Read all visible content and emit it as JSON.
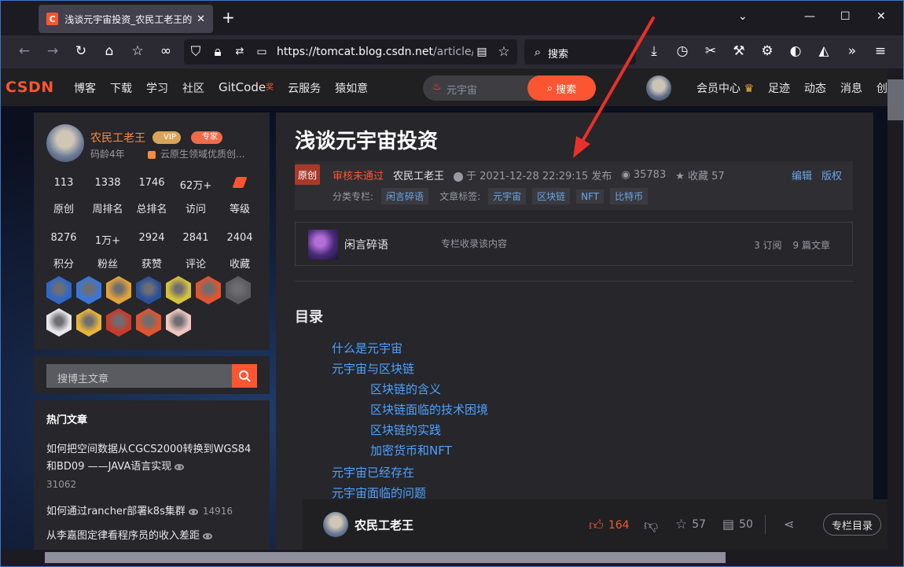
{
  "browser": {
    "tab_title": "浅谈元宇宙投资_农民工老王的博客",
    "tab_favicon": "C",
    "url_host": "https://tomcat.blog.csdn.net",
    "url_path": "/article/d",
    "search_placeholder": "搜索"
  },
  "csdn_header": {
    "logo": "CSDN",
    "nav": [
      "博客",
      "下载",
      "学习",
      "社区",
      "GitCode",
      "云服务",
      "猿如意"
    ],
    "gitcode_badge": "奖",
    "search_placeholder": "元宇宙",
    "search_button": "搜索",
    "right_links": [
      "会员中心",
      "足迹",
      "动态",
      "消息",
      "创"
    ]
  },
  "profile": {
    "name": "农民工老王",
    "vip_badge": "VIP",
    "expert_badge": "专家",
    "age": "码龄4年",
    "field": "云原生领域优质创...",
    "stats_row1": [
      {
        "value": "113",
        "label": "原创"
      },
      {
        "value": "1338",
        "label": "周排名"
      },
      {
        "value": "1746",
        "label": "总排名"
      },
      {
        "value": "62万+",
        "label": "访问"
      },
      {
        "value": "",
        "label": "等级"
      }
    ],
    "stats_row2": [
      {
        "value": "8276",
        "label": "积分"
      },
      {
        "value": "1万+",
        "label": "粉丝"
      },
      {
        "value": "2924",
        "label": "获赞"
      },
      {
        "value": "2841",
        "label": "评论"
      },
      {
        "value": "2404",
        "label": "收藏"
      }
    ],
    "medals": [
      {
        "name": "rocket-medal-blue",
        "color": "#2f67c8"
      },
      {
        "name": "rocket-medal-blue-2",
        "color": "#3a76d8"
      },
      {
        "name": "1024-medal-gold",
        "color": "#e2a33a"
      },
      {
        "name": "rocket-medal-navy",
        "color": "#2a4f9a"
      },
      {
        "name": "creator-medal-rainbow",
        "color": "#d8c23a"
      },
      {
        "name": "gift-medal-red",
        "color": "#e2542e"
      },
      {
        "name": "qi-medal-gray",
        "color": "#5a5a61"
      },
      {
        "name": "1024-medal-white",
        "color": "#e8e8ea"
      },
      {
        "name": "medal-gold-ribbon",
        "color": "#e8b43a"
      },
      {
        "name": "pen-medal-red",
        "color": "#c83a2a"
      },
      {
        "name": "monkey-medal-red",
        "color": "#e2542e"
      },
      {
        "name": "monkey-medal-pink",
        "color": "#f0c8c0"
      }
    ]
  },
  "side_search": {
    "placeholder": "搜博主文章"
  },
  "hot": {
    "title": "热门文章",
    "items": [
      {
        "text": "如何把空间数据从CGCS2000转换到WGS84和BD09 ——JAVA语言实现",
        "count": "31062"
      },
      {
        "text": "如何通过rancher部署k8s集群",
        "count": "14916"
      },
      {
        "text": "从李嘉图定律看程序员的收入差距",
        "count": ""
      }
    ]
  },
  "article": {
    "title": "浅谈元宇宙投资",
    "original": "原创",
    "review_status": "审核未通过",
    "author": "农民工老王",
    "published": "于 2021-12-28 22:29:15 发布",
    "views": "35783",
    "favorites": "收藏 57",
    "edit": "编辑",
    "copyright": "版权",
    "column_label": "分类专栏:",
    "column_tag": "闲言碎语",
    "tags_label": "文章标签:",
    "tags": [
      "元宇宙",
      "区块链",
      "NFT",
      "比特币"
    ],
    "column_card": {
      "name": "闲言碎语",
      "desc": "专栏收录该内容",
      "subs": "3 订阅",
      "articles": "9 篇文章"
    },
    "toc_title": "目录",
    "toc": [
      {
        "text": "什么是元宇宙",
        "level": 1
      },
      {
        "text": "元宇宙与区块链",
        "level": 1
      },
      {
        "text": "区块链的含义",
        "level": 2
      },
      {
        "text": "区块链面临的技术困境",
        "level": 2
      },
      {
        "text": "区块链的实践",
        "level": 2
      },
      {
        "text": "加密货币和NFT",
        "level": 2
      },
      {
        "text": "元宇宙已经存在",
        "level": 1
      },
      {
        "text": "元宇宙面临的问题",
        "level": 1
      }
    ]
  },
  "toolbar": {
    "author": "农民工老王",
    "likes": "164",
    "favorites": "57",
    "comments": "50",
    "column_button": "专栏目录"
  },
  "colors": {
    "accent": "#fc5531",
    "link": "#4ea2ff",
    "annotation": "#e8312a"
  }
}
